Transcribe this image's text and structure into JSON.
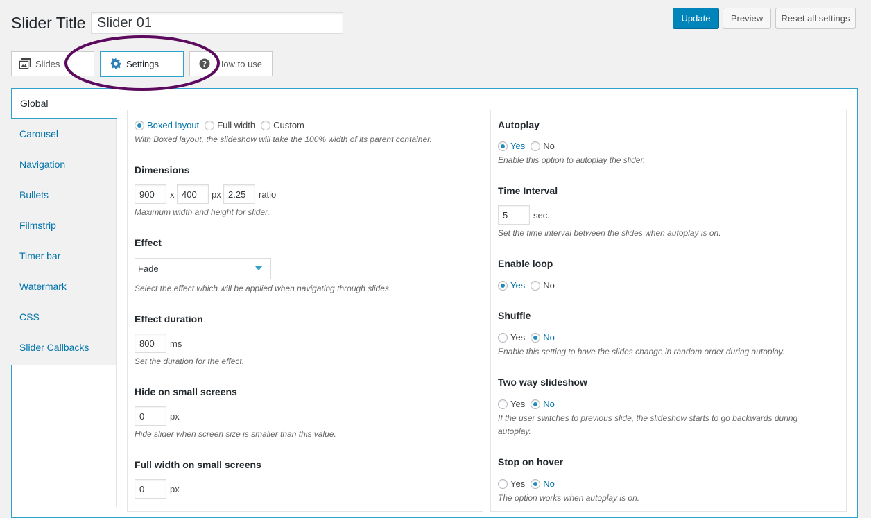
{
  "header": {
    "title_label": "Slider Title",
    "title_value": "Slider 01",
    "update_label": "Update",
    "preview_label": "Preview",
    "reset_label": "Reset all settings"
  },
  "tabs": [
    {
      "label": "Slides",
      "icon": "images-icon"
    },
    {
      "label": "Settings",
      "icon": "gear-icon"
    },
    {
      "label": "How to use",
      "icon": "question-icon"
    }
  ],
  "sidebar": {
    "items": [
      {
        "label": "Global"
      },
      {
        "label": "Carousel"
      },
      {
        "label": "Navigation"
      },
      {
        "label": "Bullets"
      },
      {
        "label": "Filmstrip"
      },
      {
        "label": "Timer bar"
      },
      {
        "label": "Watermark"
      },
      {
        "label": "CSS"
      },
      {
        "label": "Slider Callbacks"
      }
    ]
  },
  "left": {
    "layout": {
      "options": [
        "Boxed layout",
        "Full width",
        "Custom"
      ],
      "selected": "Boxed layout",
      "desc": "With Boxed layout, the slideshow will take the 100% width of its parent container."
    },
    "dimensions": {
      "heading": "Dimensions",
      "width": "900",
      "x": "x",
      "height": "400",
      "unit": "px",
      "ratio": "2.25",
      "ratio_label": "ratio",
      "desc": "Maximum width and height for slider."
    },
    "effect": {
      "heading": "Effect",
      "value": "Fade",
      "desc": "Select the effect which will be applied when navigating through slides."
    },
    "effect_duration": {
      "heading": "Effect duration",
      "value": "800",
      "unit": "ms",
      "desc": "Set the duration for the effect."
    },
    "hide_small": {
      "heading": "Hide on small screens",
      "value": "0",
      "unit": "px",
      "desc": "Hide slider when screen size is smaller than this value."
    },
    "full_width_small": {
      "heading": "Full width on small screens",
      "value": "0",
      "unit": "px"
    }
  },
  "right": {
    "autoplay": {
      "heading": "Autoplay",
      "yes": "Yes",
      "no": "No",
      "selected": "Yes",
      "desc": "Enable this option to autoplay the slider."
    },
    "time_interval": {
      "heading": "Time Interval",
      "value": "5",
      "unit": "sec.",
      "desc": "Set the time interval between the slides when autoplay is on."
    },
    "enable_loop": {
      "heading": "Enable loop",
      "yes": "Yes",
      "no": "No",
      "selected": "Yes"
    },
    "shuffle": {
      "heading": "Shuffle",
      "yes": "Yes",
      "no": "No",
      "selected": "No",
      "desc": "Enable this setting to have the slides change in random order during autoplay."
    },
    "two_way": {
      "heading": "Two way slideshow",
      "yes": "Yes",
      "no": "No",
      "selected": "No",
      "desc1": "If the user switches to previous slide, the slideshow starts to go backwards during",
      "desc2": "autoplay."
    },
    "stop_hover": {
      "heading": "Stop on hover",
      "yes": "Yes",
      "no": "No",
      "selected": "No",
      "desc": "The option works when autoplay is on."
    }
  },
  "colors": {
    "accent": "#2ea2cc",
    "link": "#0073aa",
    "primary_button": "#0085ba",
    "annotation": "#5c0a5e"
  }
}
